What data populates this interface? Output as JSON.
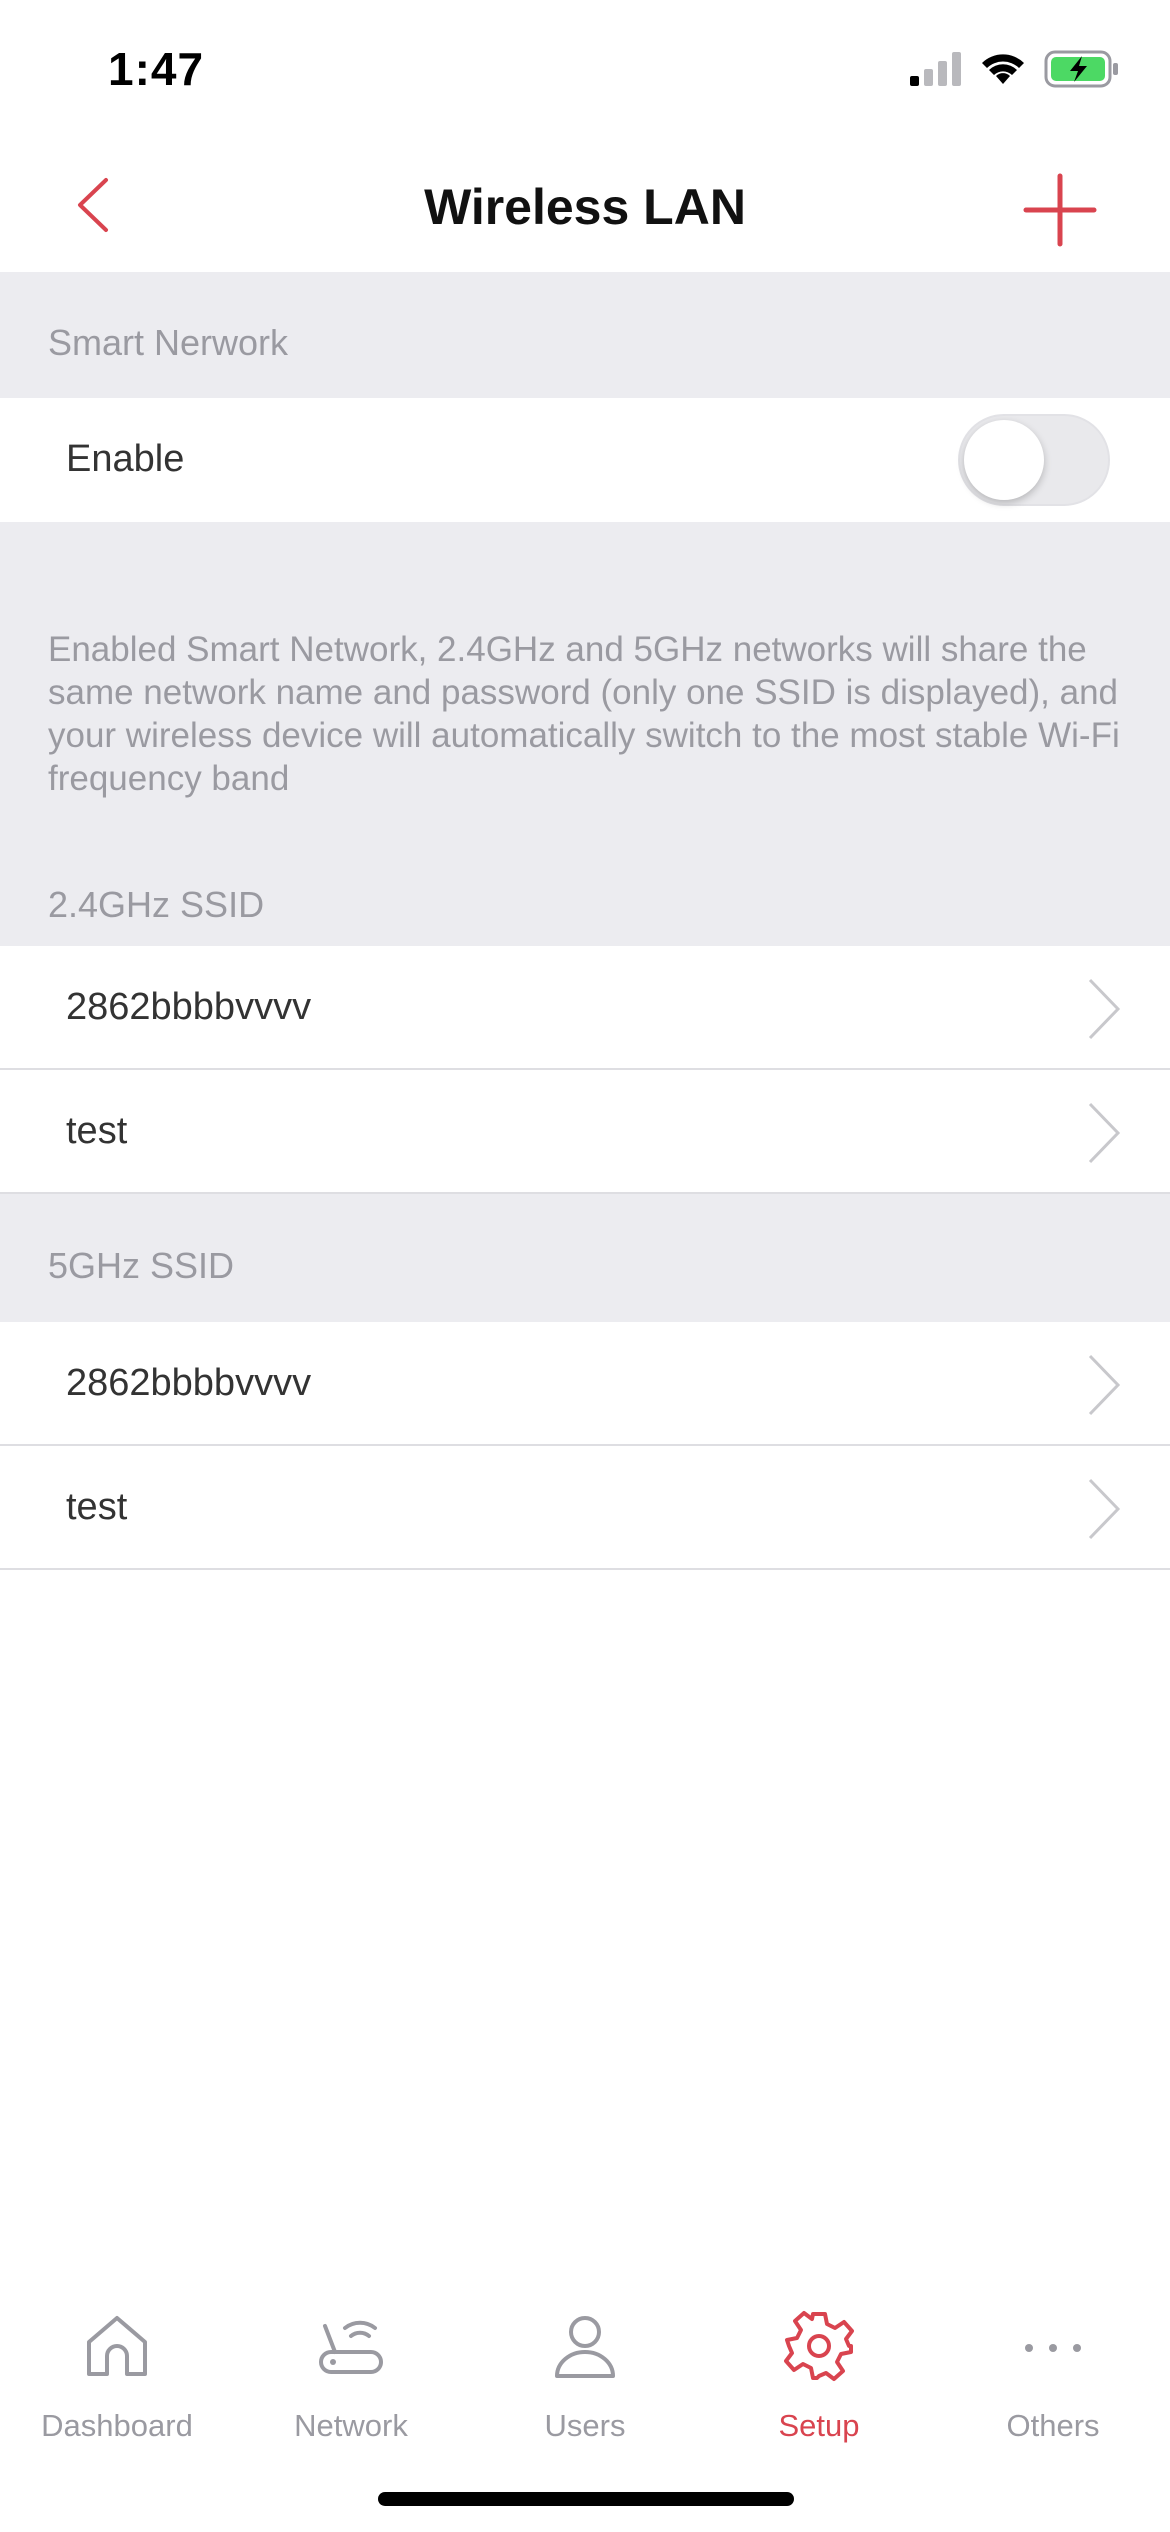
{
  "status_bar": {
    "time": "1:47"
  },
  "nav": {
    "title": "Wireless LAN",
    "back_icon": "chevron-left-icon",
    "add_icon": "plus-icon"
  },
  "colors": {
    "accent": "#d9444f",
    "section_bg": "#ececf0",
    "muted_text": "#9a9aa1"
  },
  "smart_network": {
    "header": "Smart Nerwork",
    "enable_label": "Enable",
    "enabled": false,
    "description": "Enabled Smart Network, 2.4GHz and 5GHz networks will share the same network name and password (only one SSID is displayed), and your wireless device will automatically switch to the most stable Wi-Fi frequency band"
  },
  "ssid_24": {
    "header": "2.4GHz SSID",
    "items": [
      {
        "label": "2862bbbbvvvv"
      },
      {
        "label": "test"
      }
    ]
  },
  "ssid_5": {
    "header": "5GHz SSID",
    "items": [
      {
        "label": "2862bbbbvvvv"
      },
      {
        "label": "test"
      }
    ]
  },
  "tabbar": {
    "items": [
      {
        "label": "Dashboard",
        "icon": "home-icon",
        "active": false
      },
      {
        "label": "Network",
        "icon": "router-icon",
        "active": false
      },
      {
        "label": "Users",
        "icon": "user-icon",
        "active": false
      },
      {
        "label": "Setup",
        "icon": "gear-icon",
        "active": true
      },
      {
        "label": "Others",
        "icon": "more-dots-icon",
        "active": false
      }
    ]
  }
}
